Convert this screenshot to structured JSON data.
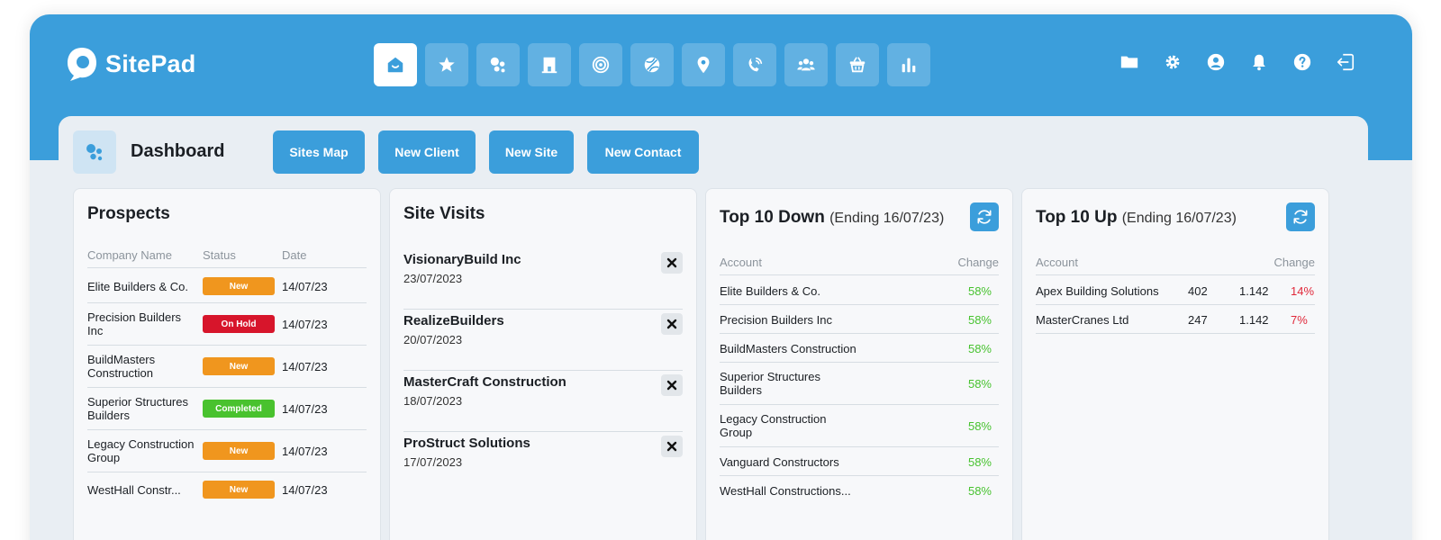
{
  "app": {
    "name": "SitePad"
  },
  "nav": [
    {
      "icon": "home-icon",
      "active": true
    },
    {
      "icon": "star-icon",
      "active": false
    },
    {
      "icon": "dashboard-icon",
      "active": false
    },
    {
      "icon": "building-icon",
      "active": false
    },
    {
      "icon": "target-icon",
      "active": false
    },
    {
      "icon": "ball-icon",
      "active": false
    },
    {
      "icon": "map-pin-icon",
      "active": false
    },
    {
      "icon": "phone-icon",
      "active": false
    },
    {
      "icon": "users-icon",
      "active": false
    },
    {
      "icon": "basket-icon",
      "active": false
    },
    {
      "icon": "bar-chart-icon",
      "active": false
    }
  ],
  "utilities": [
    "folder-icon",
    "gear-icon",
    "user-circle-icon",
    "bell-icon",
    "help-icon",
    "logout-icon"
  ],
  "dashboard": {
    "title": "Dashboard",
    "actions": [
      "Sites Map",
      "New Client",
      "New Site",
      "New Contact"
    ]
  },
  "prospects": {
    "title": "Prospects",
    "columns": [
      "Company Name",
      "Status",
      "Date"
    ],
    "rows": [
      {
        "company": "Elite Builders & Co.",
        "status": "New",
        "status_color": "#f0961e",
        "date": "14/07/23"
      },
      {
        "company": "Precision Builders Inc",
        "status": "On Hold",
        "status_color": "#d7152b",
        "date": "14/07/23"
      },
      {
        "company": "BuildMasters Construction",
        "status": "New",
        "status_color": "#f0961e",
        "date": "14/07/23"
      },
      {
        "company": "Superior Structures Builders",
        "status": "Completed",
        "status_color": "#49c22e",
        "date": "14/07/23"
      },
      {
        "company": "Legacy Construction Group",
        "status": "New",
        "status_color": "#f0961e",
        "date": "14/07/23"
      },
      {
        "company": "WestHall Constr...",
        "status": "New",
        "status_color": "#f0961e",
        "date": "14/07/23"
      }
    ]
  },
  "site_visits": {
    "title": "Site Visits",
    "items": [
      {
        "name": "VisionaryBuild Inc",
        "date": "23/07/2023"
      },
      {
        "name": "RealizeBuilders",
        "date": "20/07/2023"
      },
      {
        "name": "MasterCraft Construction",
        "date": "18/07/2023"
      },
      {
        "name": "ProStruct Solutions",
        "date": "17/07/2023"
      }
    ]
  },
  "top_down": {
    "title": "Top 10 Down",
    "subtitle": "(Ending 16/07/23)",
    "columns": [
      "Account",
      "Change"
    ],
    "rows": [
      {
        "account": "Elite Builders & Co.",
        "change": "58%"
      },
      {
        "account": "Precision Builders Inc",
        "change": "58%"
      },
      {
        "account": "BuildMasters Construction",
        "change": "58%"
      },
      {
        "account": "Superior Structures Builders",
        "change": "58%"
      },
      {
        "account": "Legacy Construction Group",
        "change": "58%"
      },
      {
        "account": "Vanguard Constructors",
        "change": "58%"
      },
      {
        "account": "WestHall Constructions...",
        "change": "58%"
      }
    ]
  },
  "top_up": {
    "title": "Top 10 Up",
    "subtitle": "(Ending 16/07/23)",
    "columns": [
      "Account",
      "Change"
    ],
    "rows": [
      {
        "account": "Apex Building Solutions",
        "v1": "402",
        "v2": "1.142",
        "change": "14%"
      },
      {
        "account": "MasterCranes Ltd",
        "v1": "247",
        "v2": "1.142",
        "change": "7%"
      }
    ]
  },
  "colors": {
    "brand": "#3b9edb",
    "positive": "#47c22f",
    "negative": "#e0283a"
  }
}
